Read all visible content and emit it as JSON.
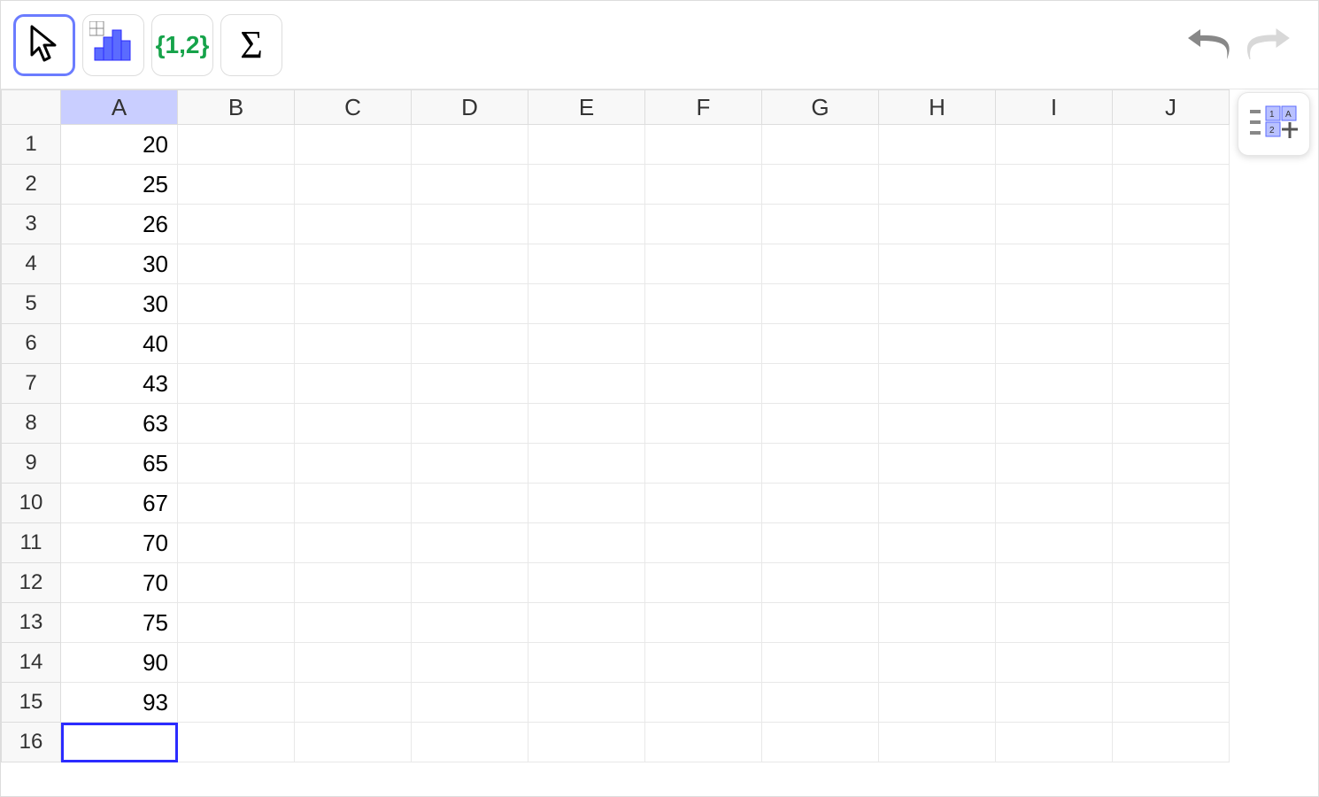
{
  "toolbar": {
    "move_selected": true
  },
  "columns": [
    "A",
    "B",
    "C",
    "D",
    "E",
    "F",
    "G",
    "H",
    "I",
    "J"
  ],
  "rows": [
    1,
    2,
    3,
    4,
    5,
    6,
    7,
    8,
    9,
    10,
    11,
    12,
    13,
    14,
    15,
    16
  ],
  "selected_column_index": 0,
  "active_cell": {
    "row": 16,
    "col": 0
  },
  "data": {
    "A": [
      "20",
      "25",
      "26",
      "30",
      "30",
      "40",
      "43",
      "63",
      "65",
      "67",
      "70",
      "70",
      "75",
      "90",
      "93",
      ""
    ]
  },
  "icons": {
    "move": "move-cursor-icon",
    "chart": "bar-chart-icon",
    "list": "list-braces-icon",
    "sigma": "sigma-icon",
    "undo": "undo-icon",
    "redo": "redo-icon",
    "panel": "panel-layout-icon"
  },
  "list_label": "{1,2}",
  "colors": {
    "accent": "#6b7cff",
    "active_border": "#2b2bff",
    "sel_bg": "#c9ceff",
    "green": "#16a34a"
  }
}
